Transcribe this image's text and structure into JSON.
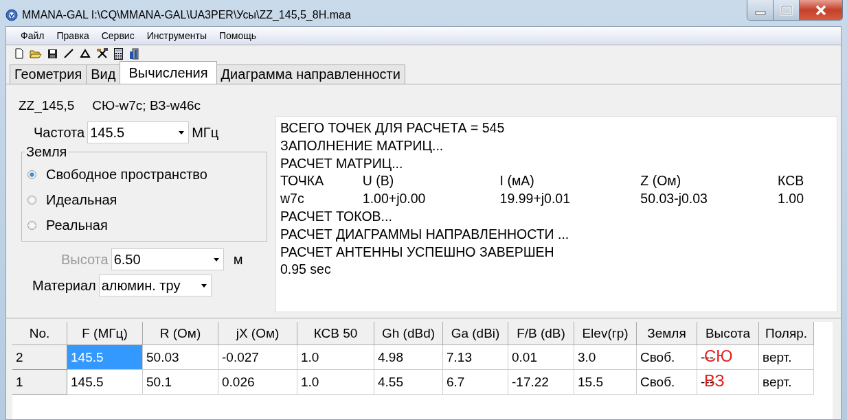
{
  "window": {
    "title": "MMANA-GAL I:\\CQ\\MMANA-GAL\\UA3PER\\Усы\\ZZ_145,5_8H.maa"
  },
  "menu": [
    "Файл",
    "Правка",
    "Сервис",
    "Инструменты",
    "Помощь"
  ],
  "tabs": [
    {
      "label": "Геометрия",
      "selected": false
    },
    {
      "label": "Вид",
      "selected": false
    },
    {
      "label": "Вычисления",
      "selected": true
    },
    {
      "label": "Диаграмма направленности",
      "selected": false
    }
  ],
  "header": {
    "name": "ZZ_145,5",
    "comment": "СЮ-w7c; ВЗ-w46c"
  },
  "frequency": {
    "label": "Частота",
    "value": "145.5",
    "unit": "МГц"
  },
  "ground": {
    "title": "Земля",
    "options": [
      {
        "label": "Свободное пространство",
        "selected": true
      },
      {
        "label": "Идеальная",
        "selected": false
      },
      {
        "label": "Реальная",
        "selected": false
      }
    ]
  },
  "height": {
    "label": "Высота",
    "value": "6.50",
    "unit": "м",
    "disabled": true
  },
  "material": {
    "label": "Материал",
    "value": "алюмин. тру"
  },
  "output": [
    {
      "kind": "text",
      "text": "ВСЕГО ТОЧЕК ДЛЯ РАСЧЕТА = 545"
    },
    {
      "kind": "text",
      "text": "ЗАПОЛНЕНИЕ МАТРИЦ..."
    },
    {
      "kind": "text",
      "text": "РАСЧЕТ МАТРИЦ..."
    },
    {
      "kind": "row",
      "cells": [
        "ТОЧКА",
        "U (В)",
        "I (мА)",
        "Z (Ом)",
        "КСВ"
      ]
    },
    {
      "kind": "row",
      "cells": [
        "w7c",
        "1.00+j0.00",
        "19.99+j0.01",
        "50.03-j0.03",
        "1.00"
      ]
    },
    {
      "kind": "text",
      "text": "РАСЧЕТ ТОКОВ..."
    },
    {
      "kind": "text",
      "text": "РАСЧЕТ ДИАГРАММЫ НАПРАВЛЕННОСТИ ..."
    },
    {
      "kind": "text",
      "text": "РАСЧЕТ АНТЕННЫ УСПЕШНО ЗАВЕРШЕН"
    },
    {
      "kind": "text",
      "text": "0.95 sec"
    }
  ],
  "table": {
    "columns": [
      "No.",
      "F (МГц)",
      "R (Ом)",
      "jX (Ом)",
      "КСВ 50",
      "Gh (dBd)",
      "Ga (dBi)",
      "F/B (dB)",
      "Elev(гр)",
      "Земля",
      "Высота",
      "Поляр."
    ],
    "rows": [
      {
        "cells": [
          {
            "text": "2",
            "selected": false
          },
          {
            "text": "145.5",
            "selected": true
          },
          {
            "text": "50.03",
            "selected": false
          },
          {
            "text": "-0.027",
            "selected": false
          },
          {
            "text": "1.0",
            "selected": false
          },
          {
            "text": "4.98",
            "selected": false
          },
          {
            "text": "7.13",
            "selected": false
          },
          {
            "text": "0.01",
            "selected": false
          },
          {
            "text": "3.0",
            "selected": false
          },
          {
            "text": "Своб.",
            "selected": false
          },
          {
            "text": "---",
            "selected": false,
            "overlay": "СЮ"
          },
          {
            "text": "верт.",
            "selected": false
          }
        ]
      },
      {
        "cells": [
          {
            "text": "1",
            "selected": false
          },
          {
            "text": "145.5",
            "selected": false
          },
          {
            "text": "50.1",
            "selected": false
          },
          {
            "text": "0.026",
            "selected": false
          },
          {
            "text": "1.0",
            "selected": false
          },
          {
            "text": "4.55",
            "selected": false
          },
          {
            "text": "6.7",
            "selected": false
          },
          {
            "text": "-17.22",
            "selected": false
          },
          {
            "text": "15.5",
            "selected": false
          },
          {
            "text": "Своб.",
            "selected": false
          },
          {
            "text": "---",
            "selected": false,
            "overlay": "ВЗ"
          },
          {
            "text": "верт.",
            "selected": false
          }
        ]
      }
    ]
  }
}
